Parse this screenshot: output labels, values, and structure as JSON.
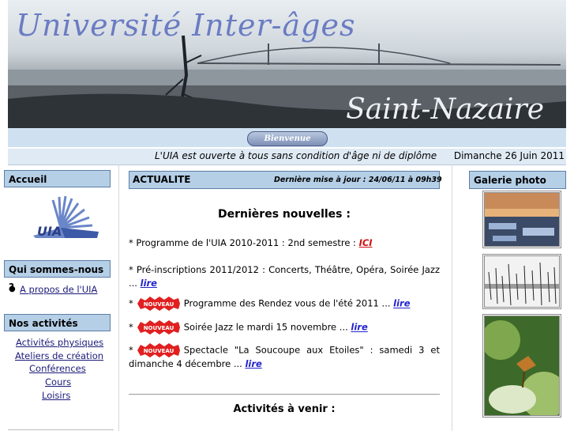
{
  "banner": {
    "title": "Université  Inter-âges",
    "city": "Saint-Nazaire",
    "welcome_button": "Bienvenue",
    "tagline": "L'UIA est ouverte à tous sans condition d'âge ni de diplôme",
    "date": "Dimanche 26 Juin 2011"
  },
  "sidebar": {
    "accueil": "Accueil",
    "qui_sommes_nous": "Qui sommes-nous ?",
    "a_propos": "A propos de l'UIA",
    "nos_activites": "Nos activités",
    "activites": [
      "Activités physiques",
      "Ateliers de création",
      "Conférences",
      "Cours",
      "Loisirs"
    ]
  },
  "main": {
    "header_title": "ACTUALITE",
    "last_update": "Dernière mise à jour : 24/06/11 à 09h39",
    "news_title": "Dernières nouvelles :",
    "news": [
      {
        "prefix": "* Programme de l'UIA 2010-2011 : 2nd semestre : ",
        "link": "ICI"
      },
      {
        "prefix": "* Pré-inscriptions 2011/2012 : Concerts, Théâtre, Opéra, Soirée Jazz ... ",
        "link": "lire"
      },
      {
        "prefix": "Programme des Rendez vous de l'été 2011 ... ",
        "link": "lire"
      },
      {
        "prefix": "Soirée Jazz le mardi 15 novembre ... ",
        "link": "lire"
      },
      {
        "prefix": "Spectacle \"La Soucoupe aux Etoiles\" : samedi 3 et dimanche 4 décembre ... ",
        "link": "lire"
      }
    ],
    "nouveau_badge": "NOUVEAU",
    "upcoming_title": "Activités à venir :"
  },
  "gallery": {
    "header": "Galerie photo"
  },
  "colors": {
    "header_bg": "#b5cfe7",
    "link": "#2323cc",
    "ici": "#cc1111",
    "banner_title": "#6a7cc2"
  }
}
